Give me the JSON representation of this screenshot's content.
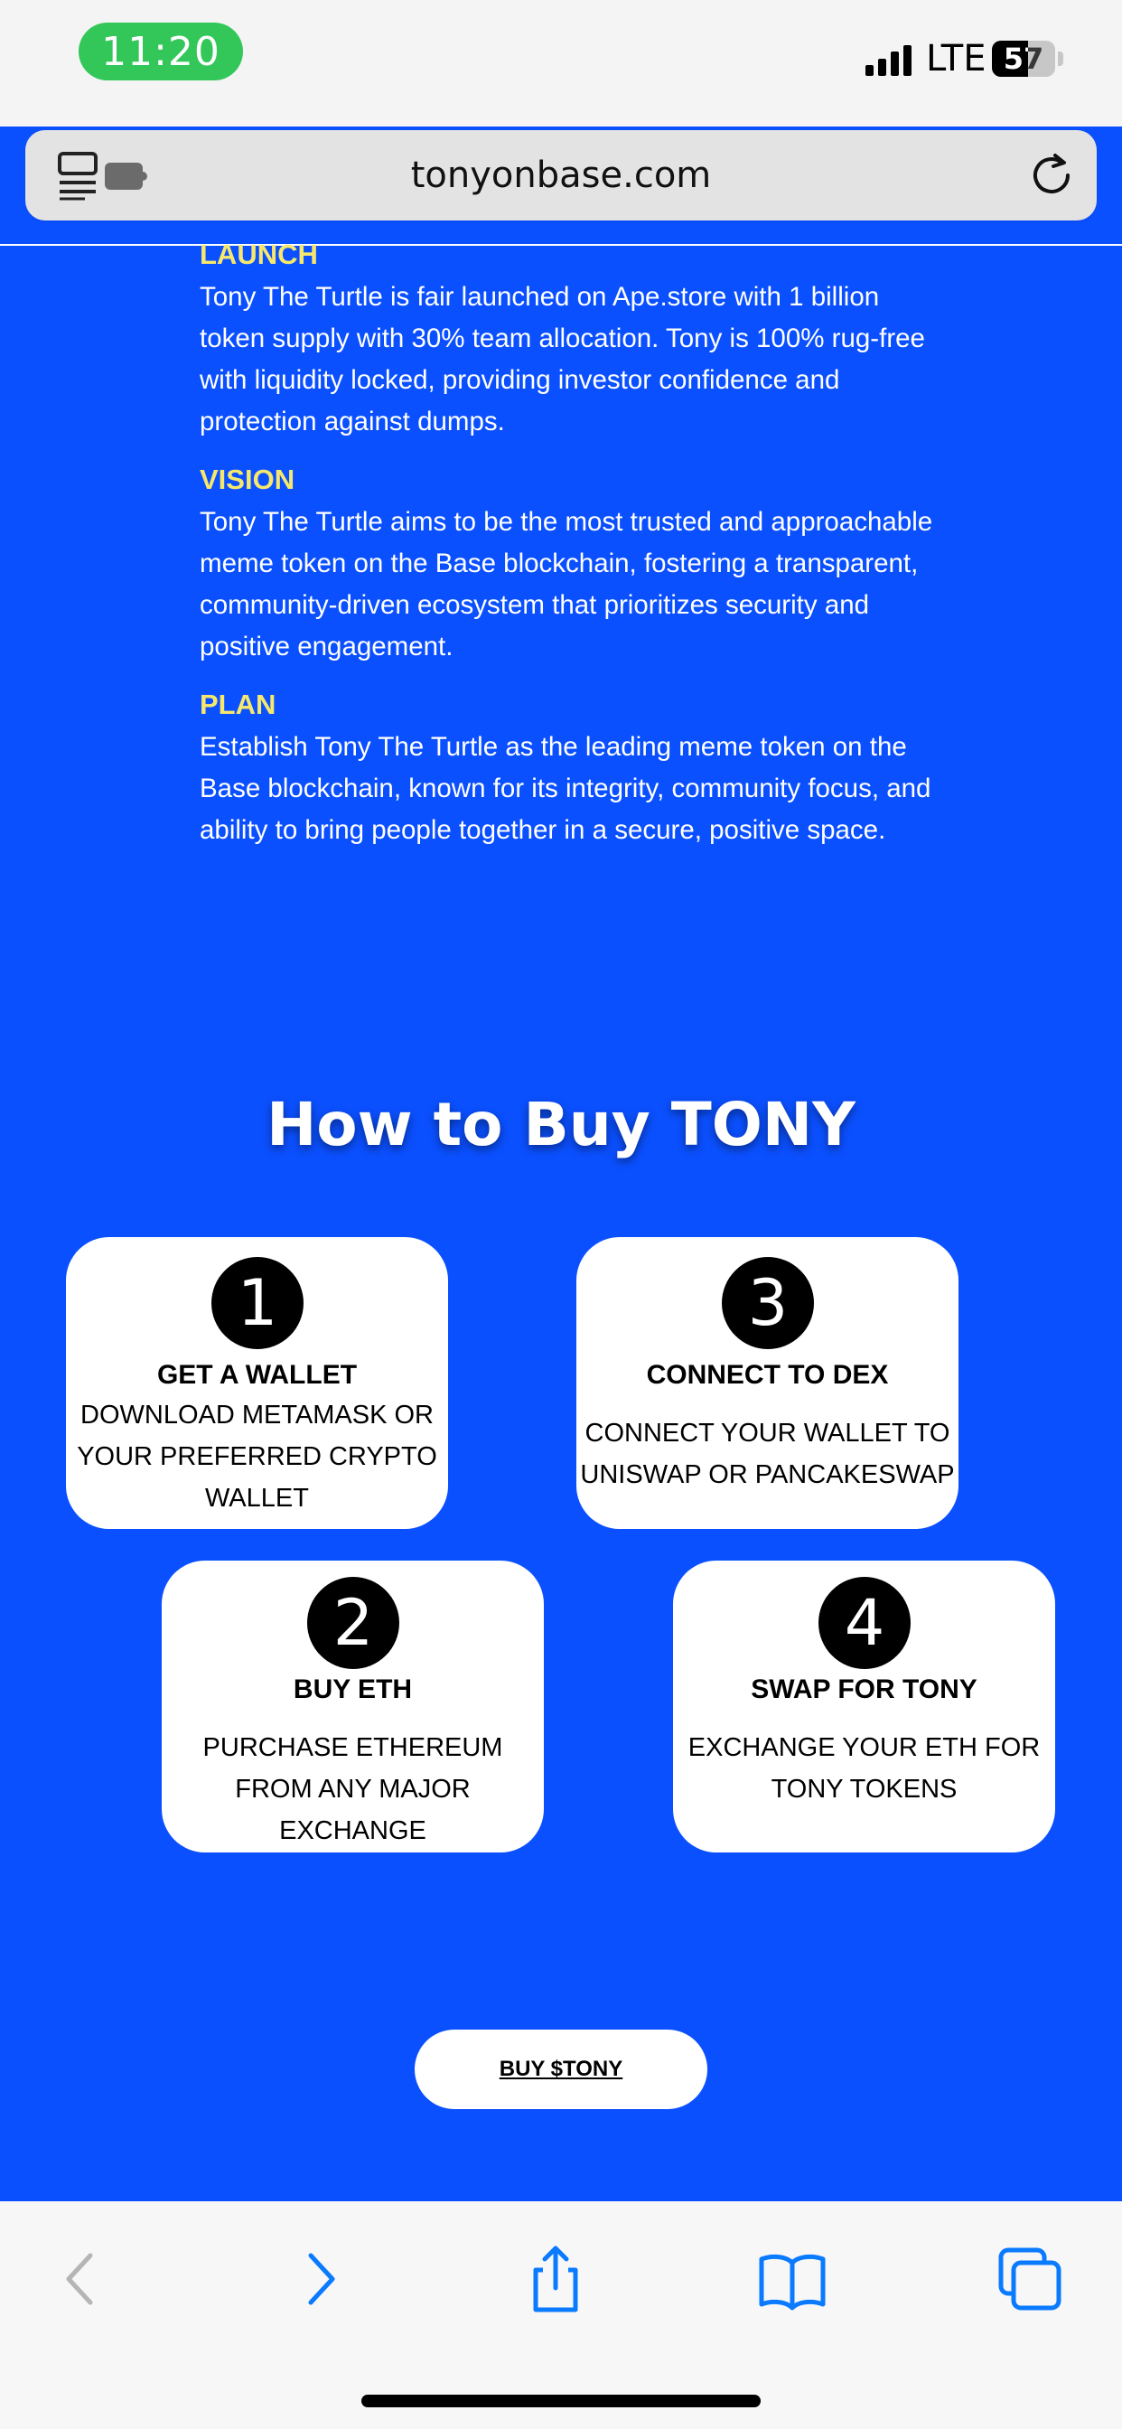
{
  "status": {
    "time": "11:20",
    "network": "LTE",
    "battery": {
      "label": "57",
      "level": 0.57
    }
  },
  "browser": {
    "url": "tonyonbase.com"
  },
  "about": [
    {
      "heading": "LAUNCH",
      "text": "Tony The Turtle is fair launched on Ape.store with 1 billion token supply with 30% team allocation. Tony is 100% rug-free with liquidity locked, providing investor confidence and protection against dumps."
    },
    {
      "heading": "VISION",
      "text": "Tony The Turtle aims to be the most trusted and approachable meme token on the Base blockchain, fostering a transparent, community-driven ecosystem that prioritizes security and positive engagement."
    },
    {
      "heading": "PLAN",
      "text": "Establish Tony The Turtle as the leading meme token on the Base blockchain, known for its integrity, community focus, and ability to bring people together in a secure, positive space."
    }
  ],
  "how_to_buy": {
    "title": "How to Buy TONY",
    "steps": [
      {
        "number": "1",
        "title": "GET A WALLET",
        "description": "DOWNLOAD METAMASK OR YOUR PREFERRED CRYPTO WALLET"
      },
      {
        "number": "3",
        "title": "CONNECT TO DEX",
        "description": "CONNECT YOUR WALLET TO UNISWAP OR PANCAKESWAP"
      },
      {
        "number": "2",
        "title": "BUY ETH",
        "description": "PURCHASE ETHEREUM FROM ANY MAJOR EXCHANGE"
      },
      {
        "number": "4",
        "title": "SWAP FOR TONY",
        "description": "EXCHANGE YOUR ETH FOR TONY TOKENS"
      }
    ]
  },
  "cta": {
    "label": "BUY $TONY"
  },
  "toolbar": {
    "icons": [
      "back-icon",
      "forward-icon",
      "share-icon",
      "bookmarks-icon",
      "tabs-icon"
    ],
    "accent": "#0a7aff"
  },
  "colors": {
    "page_bg": "#0b50ff",
    "heading": "#f6e86c",
    "status_green": "#33c759"
  }
}
